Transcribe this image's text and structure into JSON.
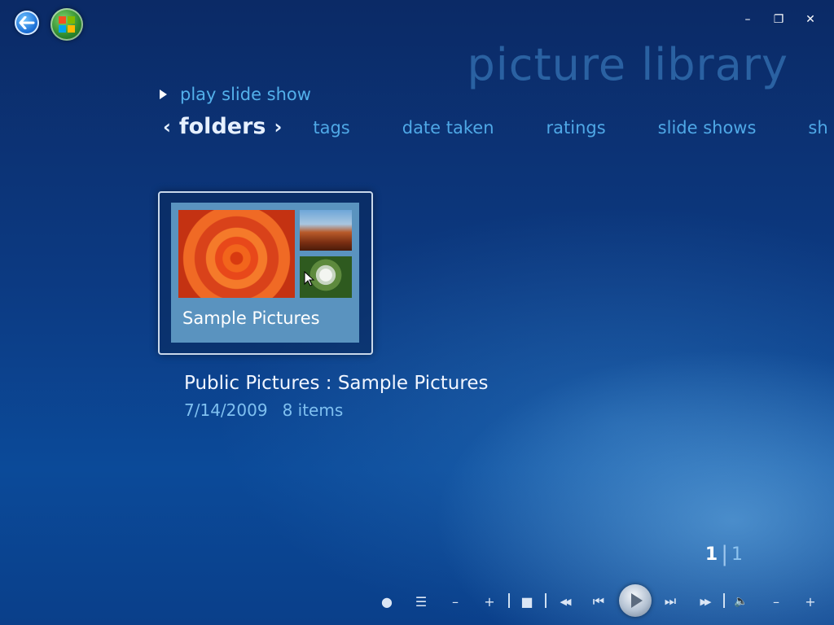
{
  "app": {
    "page_title": "picture library"
  },
  "window_controls": {
    "minimize": "–",
    "restore": "❐",
    "close": "✕"
  },
  "nav": {
    "back_icon": "back-arrow-icon",
    "start_icon": "windows-logo-icon"
  },
  "actions": {
    "play_slide_show": "play slide show"
  },
  "pivot": {
    "active": "folders",
    "left_chevron": "‹",
    "right_chevron": "›",
    "tabs": [
      "tags",
      "date taken",
      "ratings",
      "slide shows",
      "sh"
    ]
  },
  "folder_tile": {
    "label": "Sample Pictures"
  },
  "details": {
    "title": "Public Pictures : Sample Pictures",
    "date": "7/14/2009",
    "items": "8 items"
  },
  "pager": {
    "current": "1",
    "separator": "|",
    "total": "1"
  },
  "transport": {
    "record": "●",
    "guide": "☰",
    "channel_down": "–",
    "channel_up": "+",
    "stop": "■",
    "rewind": "◀◀",
    "skip_back": "⏮",
    "skip_forward": "⏭",
    "fast_forward": "▶▶",
    "mute": "🔈",
    "volume_down": "–",
    "volume_up": "+"
  },
  "colors": {
    "accent_text": "#4fa8e6",
    "title_faded": "#468ccd",
    "tile_bg": "#5a93bf"
  }
}
